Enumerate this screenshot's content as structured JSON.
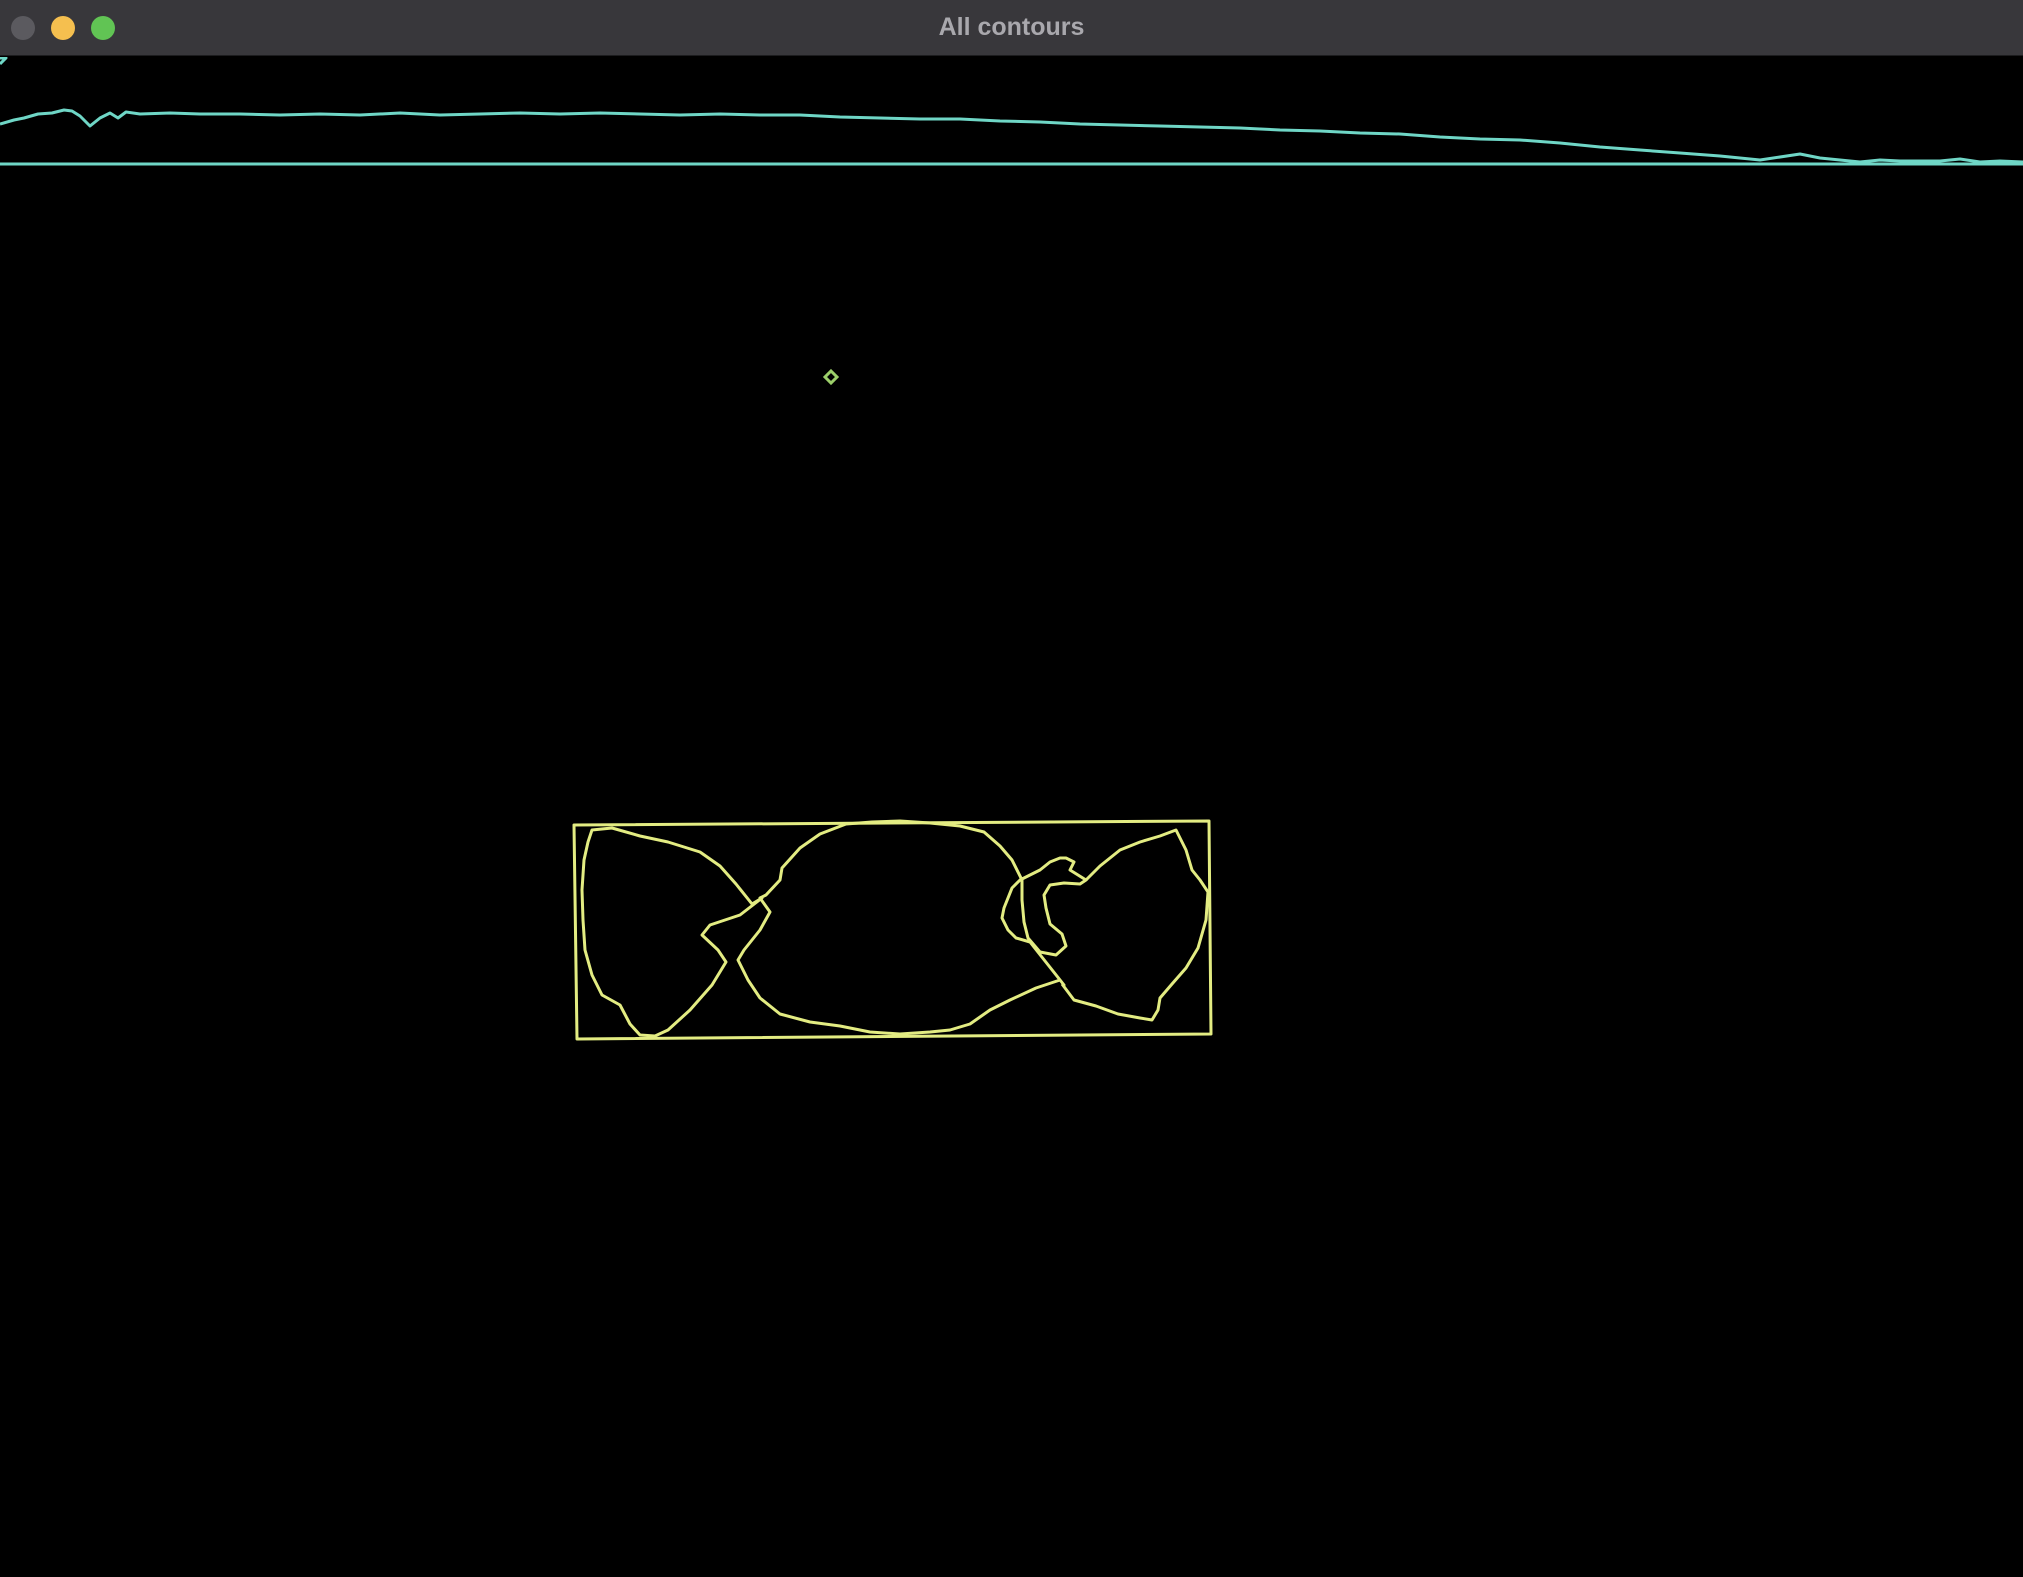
{
  "window": {
    "title": "All contours"
  },
  "traffic_lights": {
    "close_color": "#5b5a5f",
    "minimize_color": "#f5bf4f",
    "maximize_color": "#61c454"
  },
  "colors": {
    "background": "#000000",
    "top_contour": "#6fd6c6",
    "object_contour": "#e3ec82",
    "small_marker": "#9ccf6a"
  }
}
